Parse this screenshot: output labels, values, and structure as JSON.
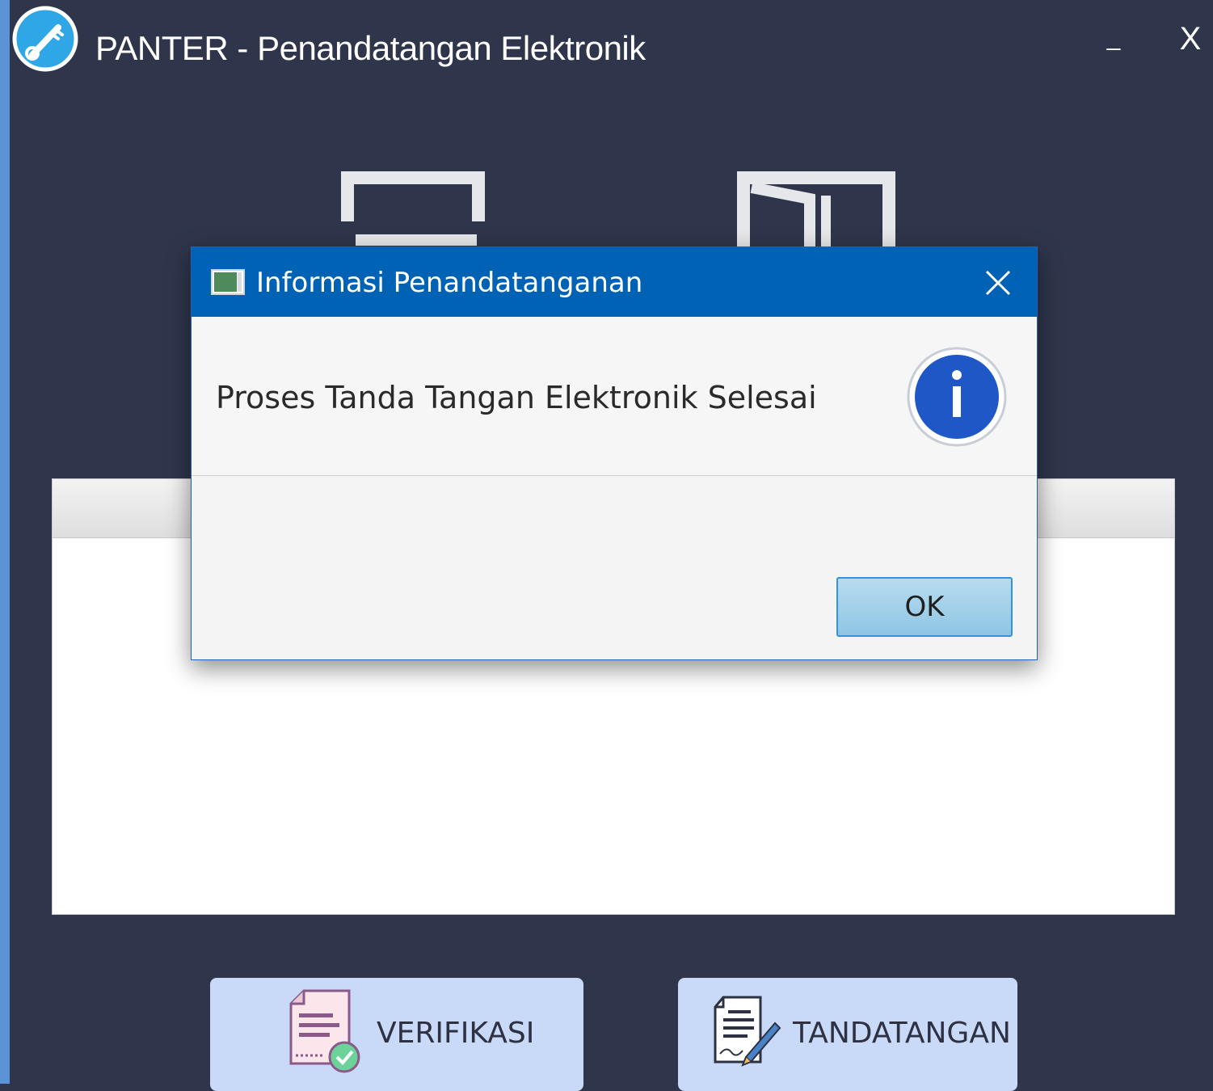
{
  "window": {
    "title": "PANTER - Penandatangan Elektronik",
    "minimize_label": "_",
    "close_label": "X"
  },
  "dialog": {
    "title": "Informasi Penandatanganan",
    "message": "Proses Tanda Tangan Elektronik Selesai",
    "ok_label": "OK",
    "icon": "info-icon"
  },
  "actions": {
    "verify_label": "VERIFIKASI",
    "sign_label": "TANDATANGAN"
  },
  "colors": {
    "background": "#2f364c",
    "dialog_titlebar": "#0062b4",
    "action_button": "#c9daf8",
    "info_blue": "#1f58c6"
  }
}
